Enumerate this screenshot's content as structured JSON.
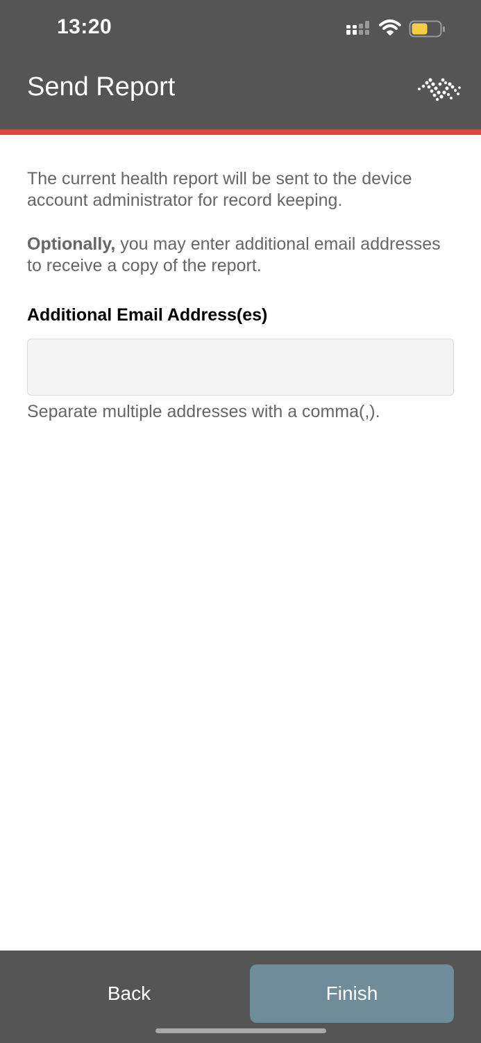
{
  "status_bar": {
    "time": "13:20",
    "icons": [
      "signal-icon",
      "wifi-icon",
      "battery-icon"
    ],
    "battery_color": "#f4cf45"
  },
  "header": {
    "title": "Send Report",
    "logo_icon": "brand-logo-icon",
    "background_color": "#555555",
    "accent_color": "#d9493a"
  },
  "main": {
    "intro": "The current health report will be sent to the device account administrator for record keeping.",
    "optional_bold": "Optionally,",
    "optional_rest": " you may enter additional email addresses to receive a copy of the report.",
    "email_label": "Additional Email Address(es)",
    "email_value": "",
    "email_placeholder": "",
    "help_text": "Separate multiple addresses with a comma(,)."
  },
  "footer": {
    "back_label": "Back",
    "finish_label": "Finish",
    "finish_color": "#6e8c99"
  }
}
